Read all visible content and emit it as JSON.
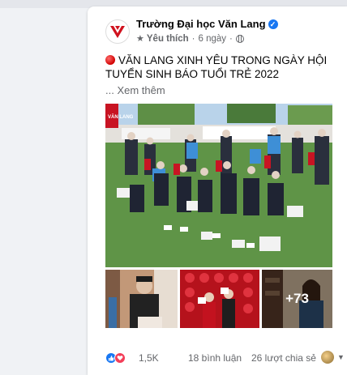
{
  "post": {
    "page_name": "Trường Đại học Văn Lang",
    "meta": {
      "like_label": "Yêu thích",
      "separator": "·",
      "time": "6 ngày",
      "separator2": "·"
    },
    "text": "VĂN LANG XINH YÊU TRONG NGÀY HỘI TUYỂN SINH BÁO TUỔI TRẺ 2022",
    "see_more": "... Xem thêm",
    "photos": {
      "more_count": "+73",
      "banner_text": "VĂN LANG"
    },
    "footer": {
      "reaction_count": "1,5K",
      "comments": "18 bình luận",
      "shares": "26 lượt chia sẻ"
    }
  },
  "colors": {
    "brand_red": "#d0121e",
    "facebook_blue": "#1877f2",
    "love_red": "#f33e58",
    "meta_gray": "#65676b"
  },
  "icons": {
    "page_avatar": "van-lang-logo",
    "verified": "verified-badge-icon",
    "like_label": "star-icon",
    "audience": "globe-icon",
    "reactions": [
      "like-icon",
      "love-icon"
    ]
  }
}
